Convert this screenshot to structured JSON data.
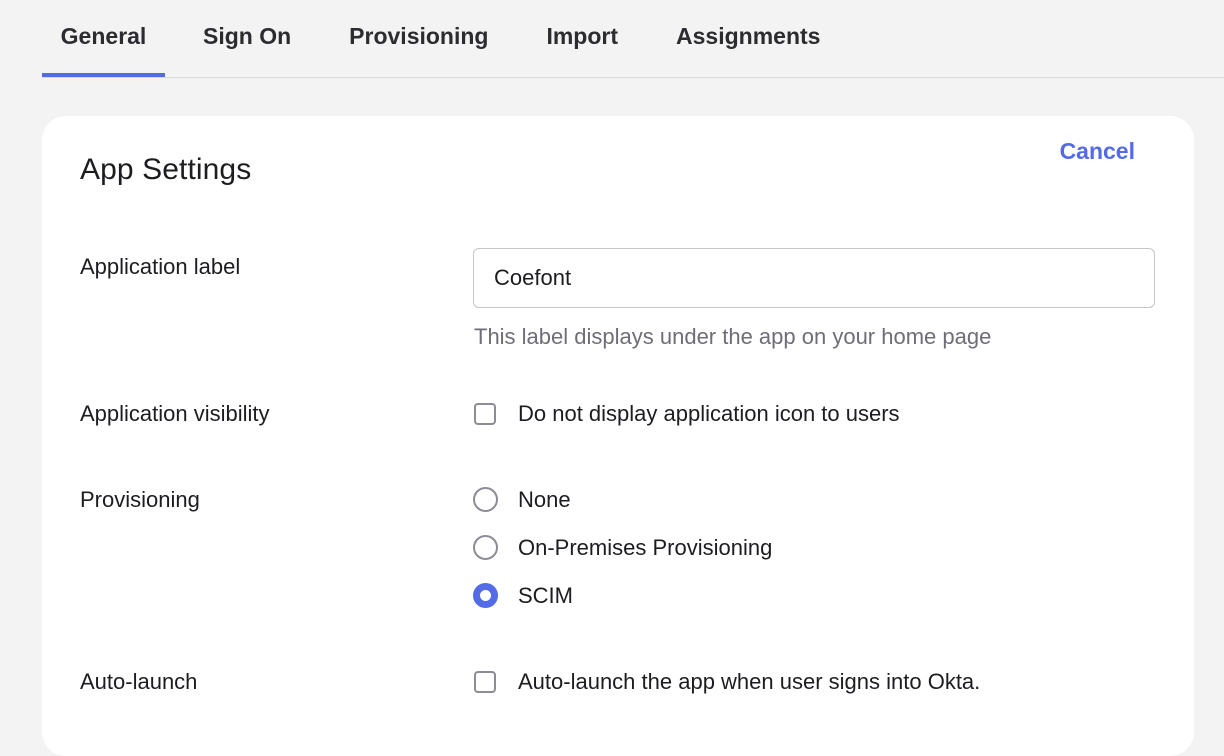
{
  "tabs": [
    {
      "label": "General",
      "active": true
    },
    {
      "label": "Sign On",
      "active": false
    },
    {
      "label": "Provisioning",
      "active": false
    },
    {
      "label": "Import",
      "active": false
    },
    {
      "label": "Assignments",
      "active": false
    }
  ],
  "card": {
    "title": "App Settings",
    "cancel_label": "Cancel"
  },
  "fields": {
    "app_label": {
      "label": "Application label",
      "value": "Coefont",
      "hint": "This label displays under the app on your home page"
    },
    "visibility": {
      "label": "Application visibility",
      "checkbox_text": "Do not display application icon to users",
      "checked": false
    },
    "provisioning": {
      "label": "Provisioning",
      "options": [
        {
          "text": "None",
          "selected": false
        },
        {
          "text": "On-Premises Provisioning",
          "selected": false
        },
        {
          "text": "SCIM",
          "selected": true
        }
      ]
    },
    "auto_launch": {
      "label": "Auto-launch",
      "checkbox_text": "Auto-launch the app when user signs into Okta.",
      "checked": false
    }
  },
  "colors": {
    "accent": "#546be7",
    "background": "#f3f3f3",
    "card": "#ffffff",
    "hint": "#6e6e78"
  }
}
